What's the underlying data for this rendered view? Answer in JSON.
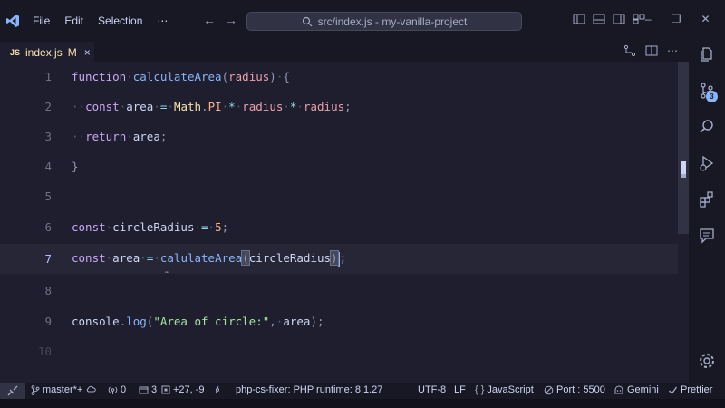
{
  "titlebar": {
    "menu": [
      "File",
      "Edit",
      "Selection",
      "⋯"
    ],
    "search_text": "src/index.js - my-vanilla-project"
  },
  "tab": {
    "icon": "JS",
    "name": "index.js",
    "modified": "M",
    "close": "×"
  },
  "editor": {
    "line_numbers": [
      "1",
      "2",
      "3",
      "4",
      "5",
      "6",
      "7",
      "8",
      "9",
      "10"
    ],
    "active_line": "7",
    "ghost_hint": "⋯"
  },
  "activity": {
    "scm_badge": "3"
  },
  "statusbar": {
    "branch": "master*+",
    "ports": "0",
    "errors": "3",
    "changes": "+27, -9",
    "php": "php-cs-fixer: PHP runtime: 8.1.27",
    "encoding": "UTF-8",
    "eol": "LF",
    "language": "JavaScript",
    "port": "Port : 5500",
    "gemini": "Gemini",
    "prettier": "Prettier"
  },
  "colors": {
    "background": "#1e1e2e",
    "accent": "#89b4fa",
    "tab_text": "#f9e2af"
  }
}
